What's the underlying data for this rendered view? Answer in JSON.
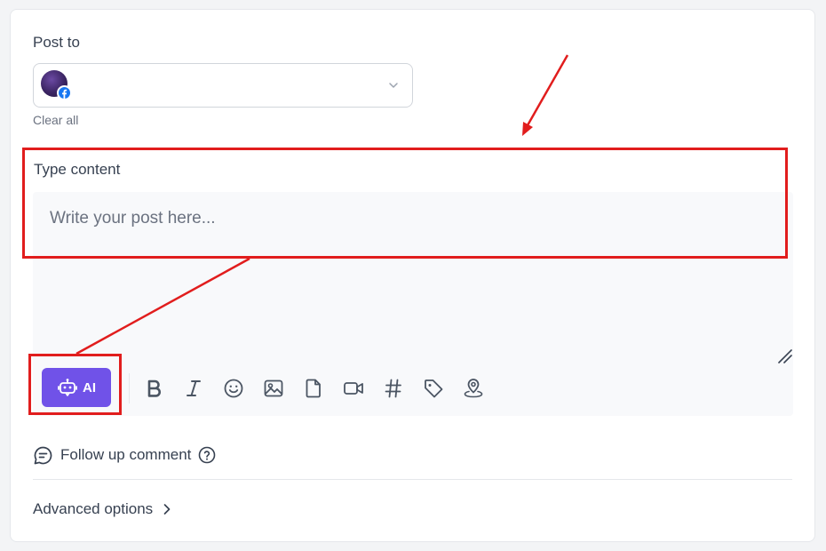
{
  "post_to": {
    "label": "Post to",
    "selected_account": {
      "avatar": "purple-space-avatar",
      "network": "facebook"
    },
    "clear_all": "Clear all"
  },
  "content": {
    "label": "Type content",
    "placeholder": "Write your post here..."
  },
  "toolbar": {
    "ai_label": "AI",
    "tools": [
      "bold-icon",
      "italic-icon",
      "emoji-icon",
      "image-icon",
      "file-icon",
      "video-icon",
      "hashtag-icon",
      "tag-icon",
      "location-icon"
    ]
  },
  "follow_up": {
    "label": "Follow up comment"
  },
  "advanced": {
    "label": "Advanced options"
  },
  "colors": {
    "accent": "#7052e8",
    "annotation": "#e11d1d",
    "facebook": "#1877f2"
  }
}
